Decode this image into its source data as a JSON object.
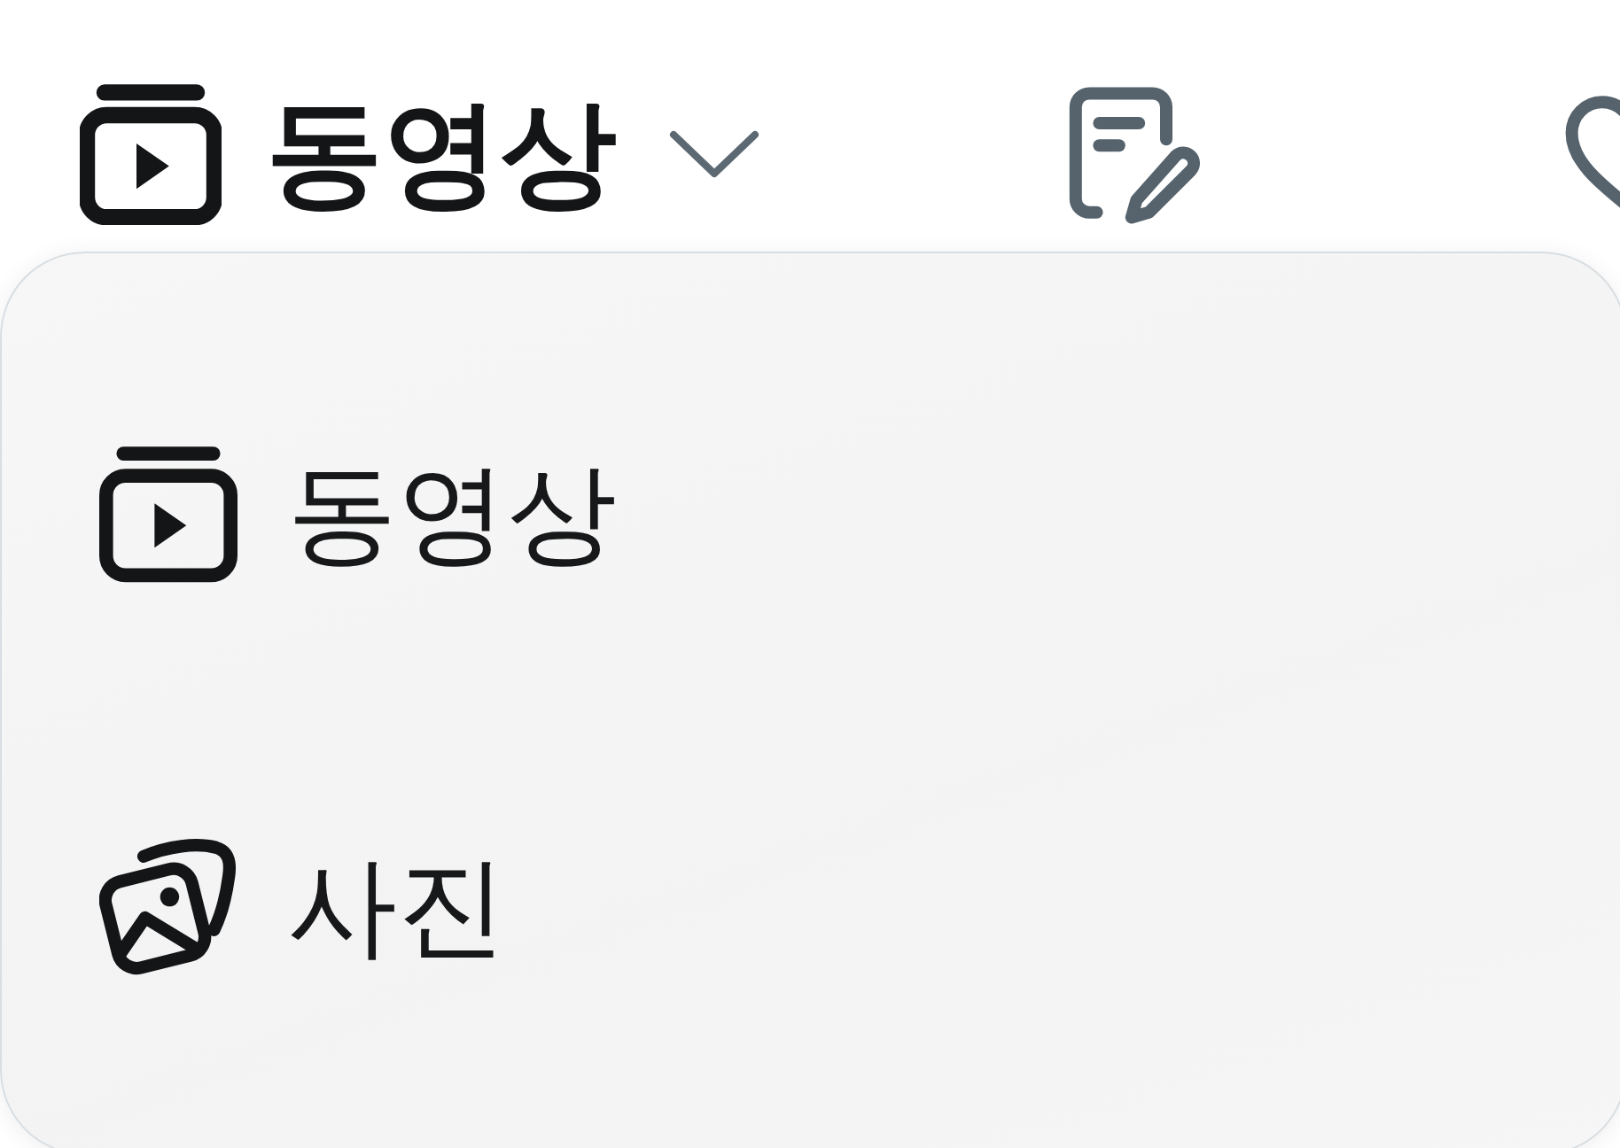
{
  "header": {
    "kind": "video",
    "title": "동영상",
    "expanded": true
  },
  "menu": {
    "items": [
      {
        "kind": "video",
        "label": "동영상"
      },
      {
        "kind": "photo",
        "label": "사진"
      }
    ]
  }
}
